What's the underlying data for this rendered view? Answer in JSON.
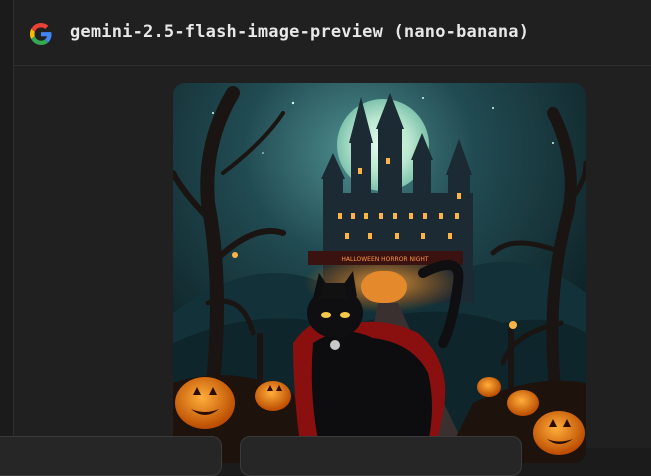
{
  "header": {
    "logo_icon": "google-g-icon",
    "title": "gemini-2.5-flash-image-preview (nano-banana)"
  },
  "image": {
    "banner_text": "HALLOWEEN HORROR NIGHT"
  },
  "colors": {
    "background": "#1b1b1b",
    "panel": "#202020",
    "title_text": "#e8e8e8",
    "border": "#2f2f2f"
  }
}
